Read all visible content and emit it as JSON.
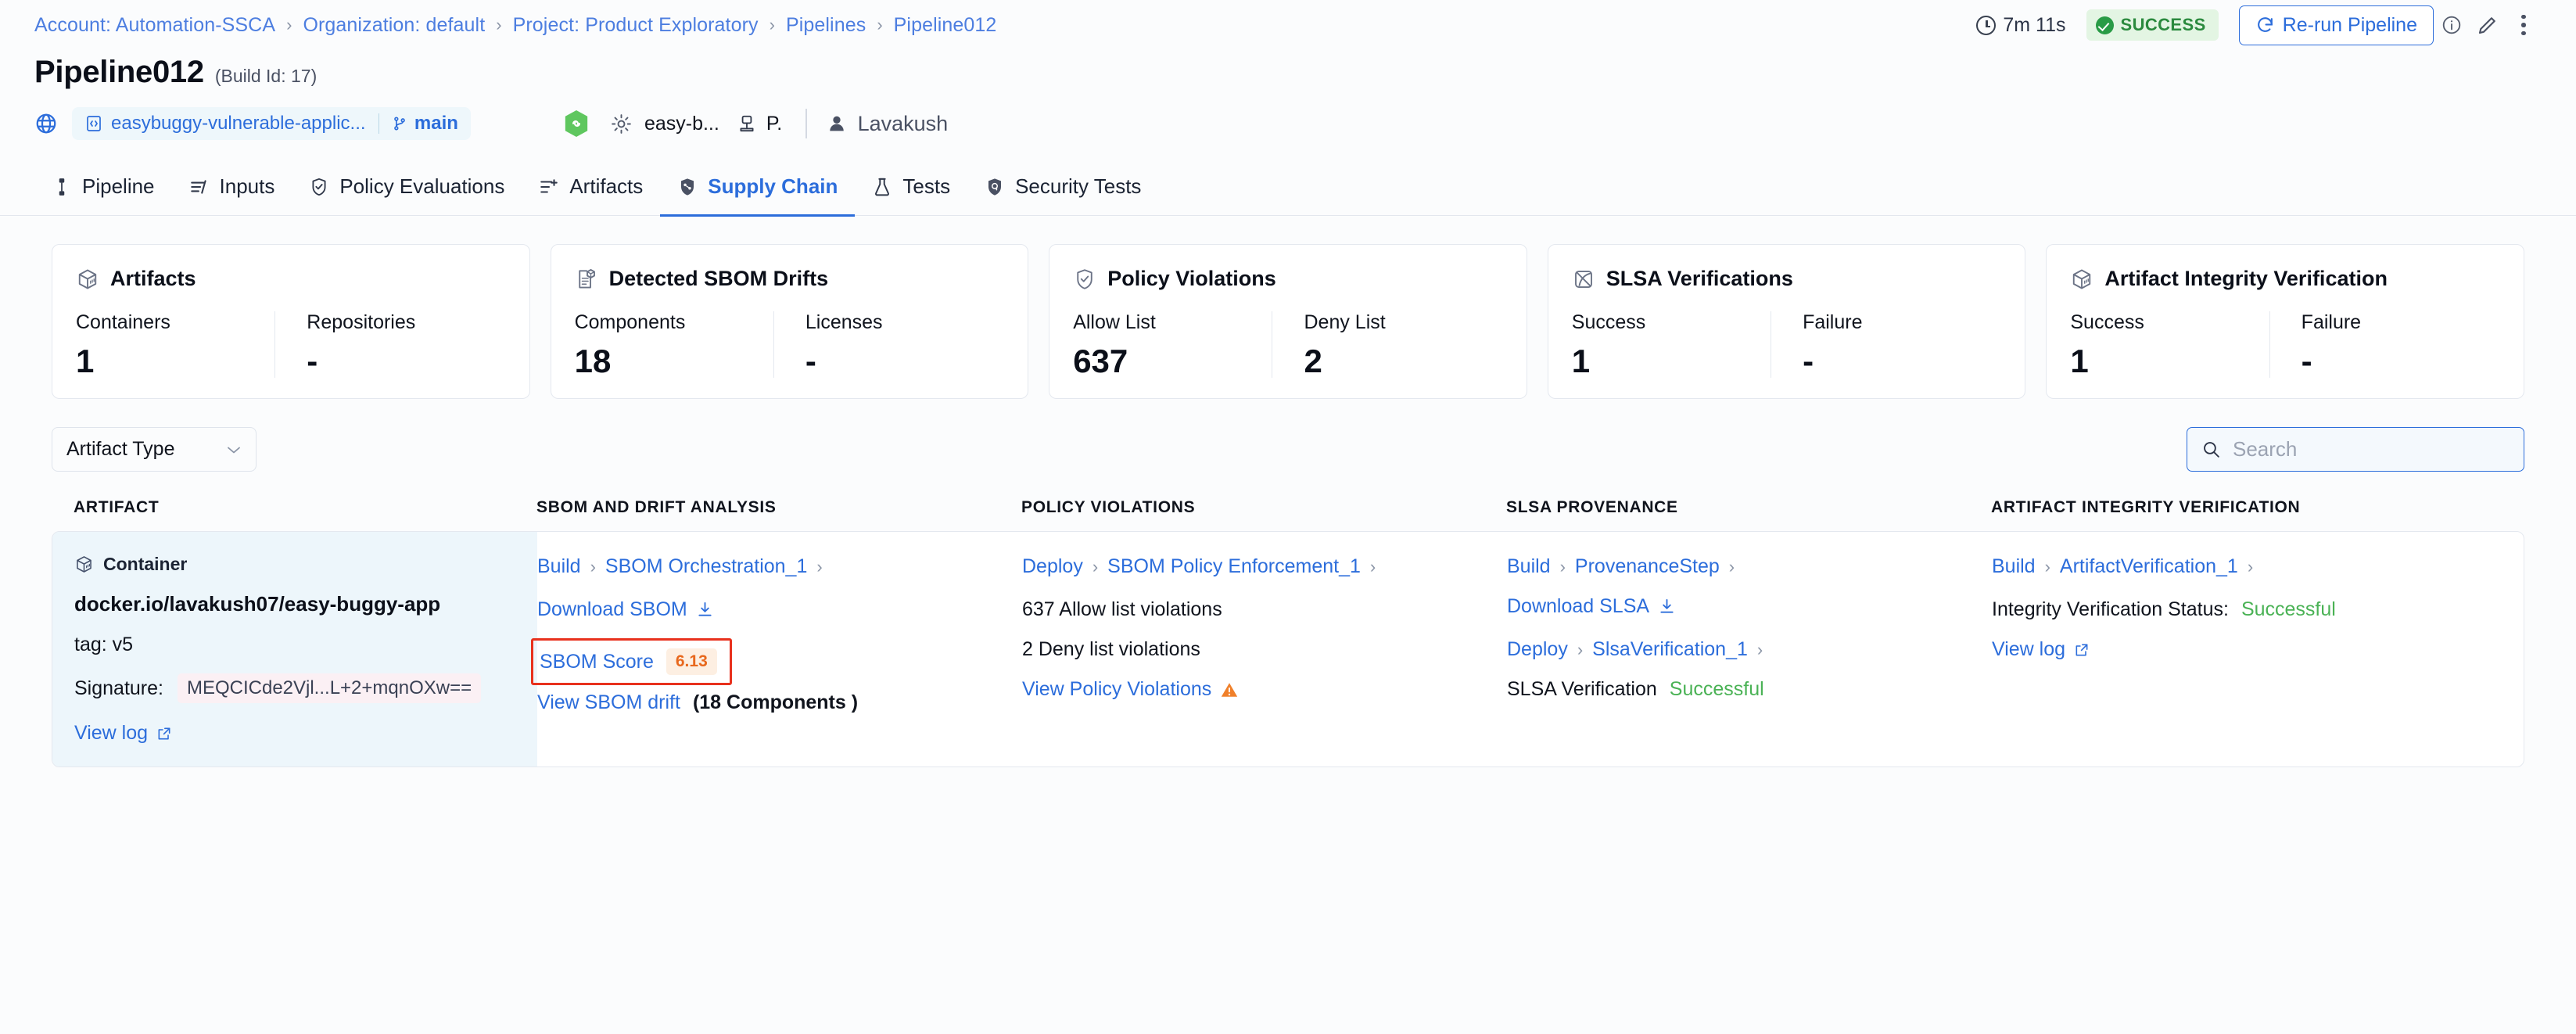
{
  "breadcrumb": {
    "items": [
      "Account: Automation-SSCA",
      "Organization: default",
      "Project: Product Exploratory",
      "Pipelines",
      "Pipeline012"
    ],
    "separator": "›"
  },
  "header": {
    "duration": "7m 11s",
    "status": "SUCCESS",
    "rerun_label": "Re-run Pipeline",
    "title": "Pipeline012",
    "build_id": "(Build Id: 17)"
  },
  "meta": {
    "repo": "easybuggy-vulnerable-applic...",
    "branch": "main",
    "service": "easy-b...",
    "env": "P.",
    "user": "Lavakush"
  },
  "tabs": [
    {
      "label": "Pipeline",
      "icon": "pipeline-icon",
      "active": false
    },
    {
      "label": "Inputs",
      "icon": "inputs-icon",
      "active": false
    },
    {
      "label": "Policy Evaluations",
      "icon": "policy-shield-icon",
      "active": false
    },
    {
      "label": "Artifacts",
      "icon": "artifacts-list-icon",
      "active": false
    },
    {
      "label": "Supply Chain",
      "icon": "supply-chain-shield-icon",
      "active": true
    },
    {
      "label": "Tests",
      "icon": "flask-icon",
      "active": false
    },
    {
      "label": "Security Tests",
      "icon": "security-shield-icon",
      "active": false
    }
  ],
  "cards": [
    {
      "title": "Artifacts",
      "icon": "cube-icon",
      "metrics": [
        {
          "label": "Containers",
          "value": "1"
        },
        {
          "label": "Repositories",
          "value": "-"
        }
      ]
    },
    {
      "title": "Detected SBOM Drifts",
      "icon": "document-cube-icon",
      "metrics": [
        {
          "label": "Components",
          "value": "18"
        },
        {
          "label": "Licenses",
          "value": "-"
        }
      ]
    },
    {
      "title": "Policy Violations",
      "icon": "shield-check-icon",
      "metrics": [
        {
          "label": "Allow List",
          "value": "637"
        },
        {
          "label": "Deny List",
          "value": "2"
        }
      ]
    },
    {
      "title": "SLSA Verifications",
      "icon": "slsa-icon",
      "metrics": [
        {
          "label": "Success",
          "value": "1"
        },
        {
          "label": "Failure",
          "value": "-"
        }
      ]
    },
    {
      "title": "Artifact Integrity Verification",
      "icon": "cube-icon",
      "metrics": [
        {
          "label": "Success",
          "value": "1"
        },
        {
          "label": "Failure",
          "value": "-"
        }
      ]
    }
  ],
  "filters": {
    "artifact_type_label": "Artifact Type",
    "search_placeholder": "Search",
    "search_value": ""
  },
  "table": {
    "columns": [
      "ARTIFACT",
      "SBOM AND DRIFT ANALYSIS",
      "POLICY VIOLATIONS",
      "SLSA PROVENANCE",
      "ARTIFACT INTEGRITY VERIFICATION"
    ],
    "row": {
      "artifact": {
        "type": "Container",
        "name": "docker.io/lavakush07/easy-buggy-app",
        "tag": "tag: v5",
        "signature_label": "Signature:",
        "signature_value": "MEQCICde2Vjl...L+2+mqnOXw==",
        "view_log": "View log"
      },
      "sbom": {
        "crumb_stage": "Build",
        "crumb_step": "SBOM Orchestration_1",
        "download_label": "Download SBOM",
        "score_label": "SBOM Score",
        "score_value": "6.13",
        "drift_link": "View SBOM drift",
        "drift_note": "(18 Components )"
      },
      "policy": {
        "crumb_stage": "Deploy",
        "crumb_step": "SBOM Policy Enforcement_1",
        "allow_line": "637 Allow list violations",
        "deny_line": "2 Deny list violations",
        "view_link": "View Policy Violations"
      },
      "slsa": {
        "crumb_stage_1": "Build",
        "crumb_step_1": "ProvenanceStep",
        "download_label": "Download SLSA",
        "crumb_stage_2": "Deploy",
        "crumb_step_2": "SlsaVerification_1",
        "verification_label": "SLSA Verification",
        "verification_status": "Successful"
      },
      "integrity": {
        "crumb_stage": "Build",
        "crumb_step": "ArtifactVerification_1",
        "status_label": "Integrity Verification Status:",
        "status_value": "Successful",
        "view_log": "View log"
      }
    }
  },
  "colors": {
    "link": "#2c6ddb",
    "success": "#2b8a3e",
    "warning": "#e8681d",
    "highlight": "#e8311d"
  }
}
